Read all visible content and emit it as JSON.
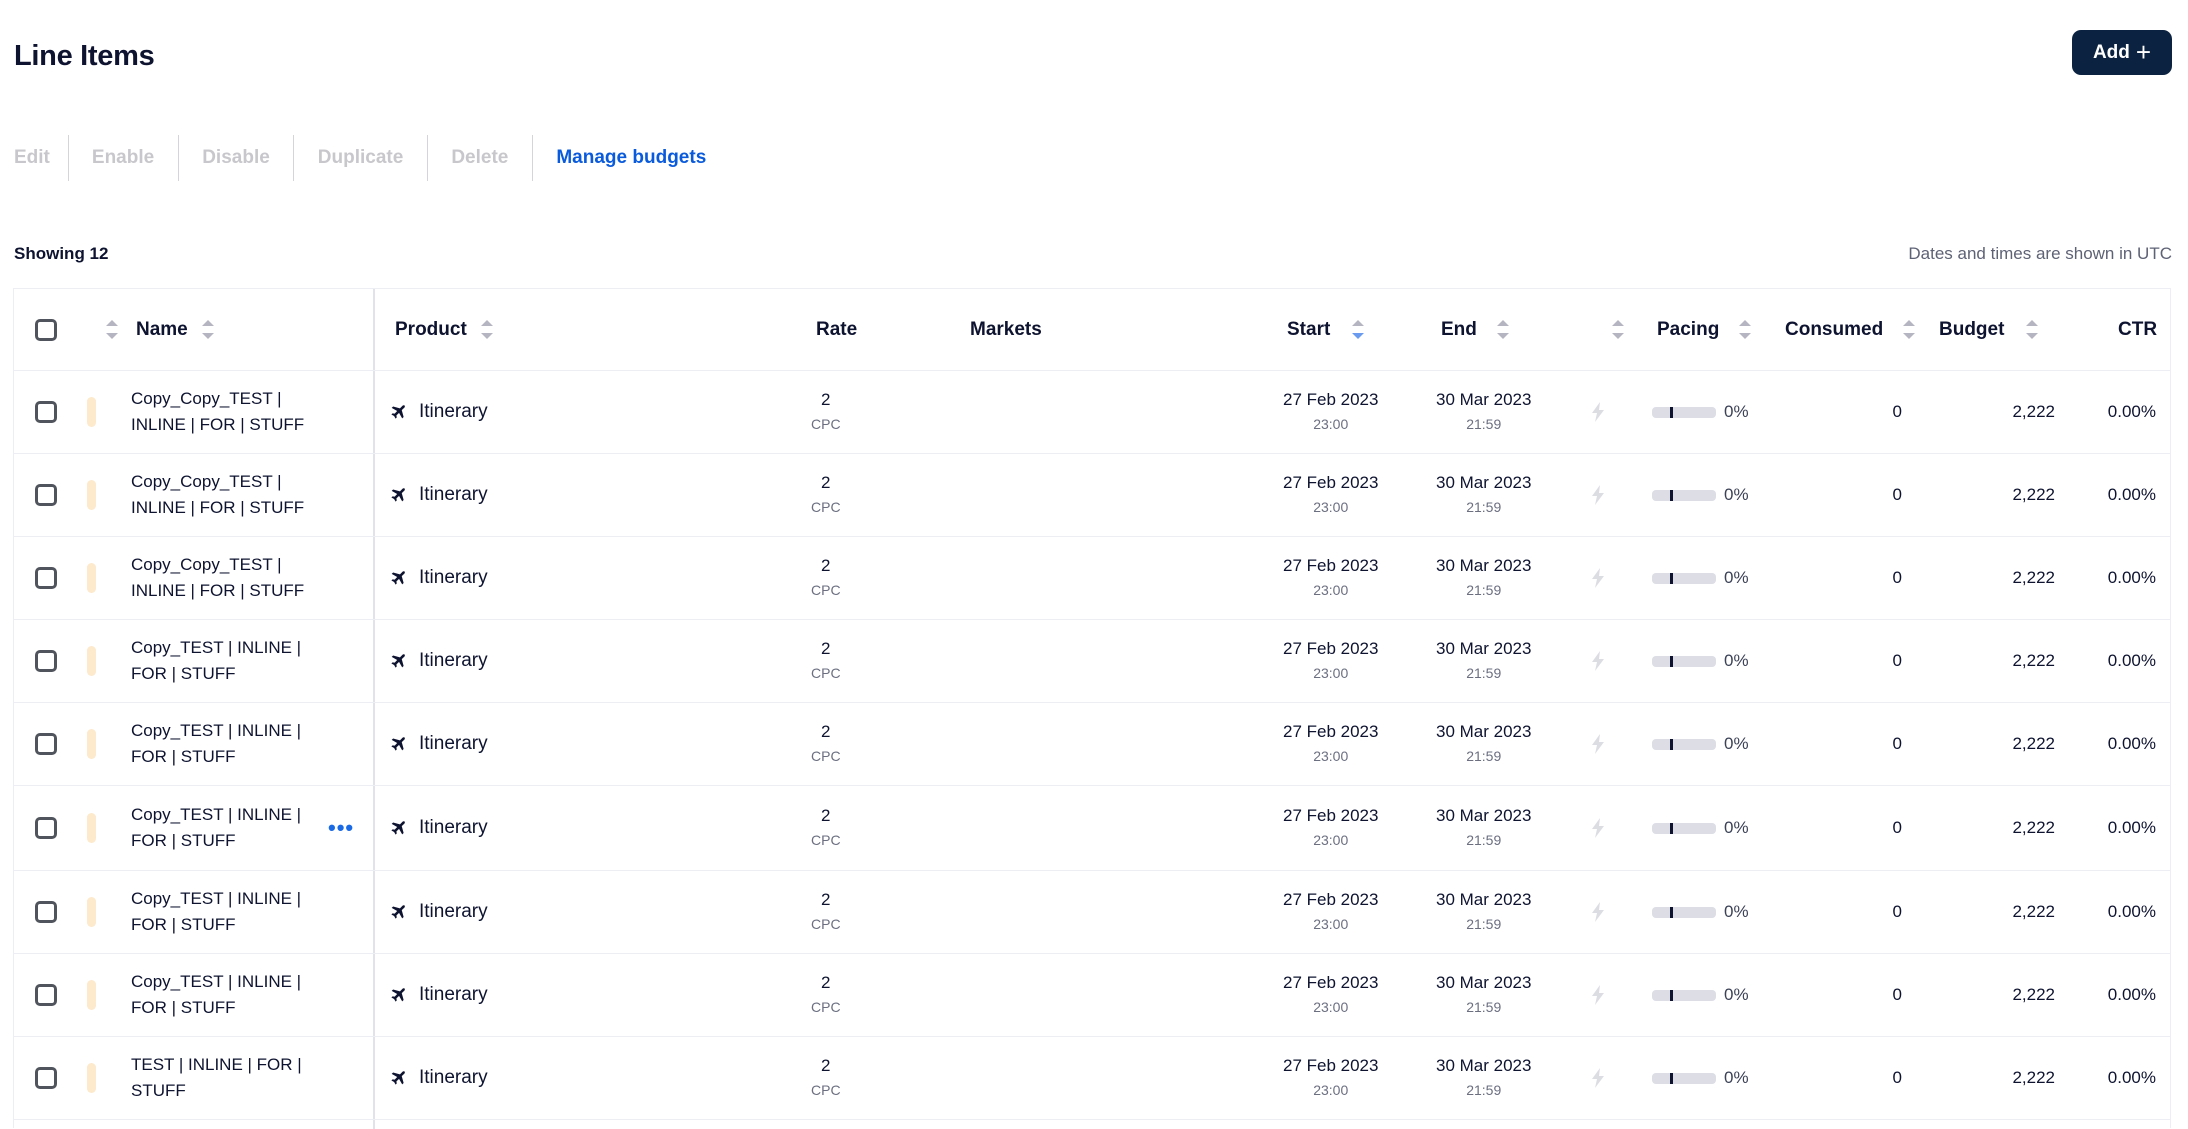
{
  "header": {
    "title": "Line Items",
    "add_button": {
      "label": "Add",
      "icon": "plus-icon"
    }
  },
  "toolbar": {
    "items": [
      {
        "label": "Edit",
        "enabled": false
      },
      {
        "label": "Enable",
        "enabled": false
      },
      {
        "label": "Disable",
        "enabled": false
      },
      {
        "label": "Duplicate",
        "enabled": false
      },
      {
        "label": "Delete",
        "enabled": false
      },
      {
        "label": "Manage budgets",
        "enabled": true
      }
    ]
  },
  "summary": {
    "showing": "Showing 12",
    "timezone_note": "Dates and times are shown in UTC"
  },
  "table": {
    "columns": {
      "name": "Name",
      "product": "Product",
      "rate": "Rate",
      "markets": "Markets",
      "start": "Start",
      "end": "End",
      "pacing": "Pacing",
      "consumed": "Consumed",
      "budget": "Budget",
      "ctr": "CTR"
    },
    "sorted_by": "start",
    "sort_direction": "descending",
    "colors": {
      "accent": "#0a5bdc",
      "status_pill": "#fde9cc",
      "add_button": "#0b2240"
    },
    "rows": [
      {
        "name": "Copy_Copy_TEST | INLINE | FOR | STUFF",
        "product": "Itinerary",
        "product_icon": "airplane-icon",
        "rate": "2",
        "rate_type": "CPC",
        "markets": "",
        "start_date": "27 Feb 2023",
        "start_time": "23:00",
        "end_date": "30 Mar 2023",
        "end_time": "21:59",
        "pacing_pct": 0,
        "pacing_label": "0%",
        "consumed": "0",
        "budget": "2,222",
        "ctr": "0.00%",
        "hover_menu": false
      },
      {
        "name": "Copy_Copy_TEST | INLINE | FOR | STUFF",
        "product": "Itinerary",
        "product_icon": "airplane-icon",
        "rate": "2",
        "rate_type": "CPC",
        "markets": "",
        "start_date": "27 Feb 2023",
        "start_time": "23:00",
        "end_date": "30 Mar 2023",
        "end_time": "21:59",
        "pacing_pct": 0,
        "pacing_label": "0%",
        "consumed": "0",
        "budget": "2,222",
        "ctr": "0.00%",
        "hover_menu": false
      },
      {
        "name": "Copy_Copy_TEST | INLINE | FOR | STUFF",
        "product": "Itinerary",
        "product_icon": "airplane-icon",
        "rate": "2",
        "rate_type": "CPC",
        "markets": "",
        "start_date": "27 Feb 2023",
        "start_time": "23:00",
        "end_date": "30 Mar 2023",
        "end_time": "21:59",
        "pacing_pct": 0,
        "pacing_label": "0%",
        "consumed": "0",
        "budget": "2,222",
        "ctr": "0.00%",
        "hover_menu": false
      },
      {
        "name": "Copy_TEST | INLINE | FOR | STUFF",
        "product": "Itinerary",
        "product_icon": "airplane-icon",
        "rate": "2",
        "rate_type": "CPC",
        "markets": "",
        "start_date": "27 Feb 2023",
        "start_time": "23:00",
        "end_date": "30 Mar 2023",
        "end_time": "21:59",
        "pacing_pct": 0,
        "pacing_label": "0%",
        "consumed": "0",
        "budget": "2,222",
        "ctr": "0.00%",
        "hover_menu": false
      },
      {
        "name": "Copy_TEST | INLINE | FOR | STUFF",
        "product": "Itinerary",
        "product_icon": "airplane-icon",
        "rate": "2",
        "rate_type": "CPC",
        "markets": "",
        "start_date": "27 Feb 2023",
        "start_time": "23:00",
        "end_date": "30 Mar 2023",
        "end_time": "21:59",
        "pacing_pct": 0,
        "pacing_label": "0%",
        "consumed": "0",
        "budget": "2,222",
        "ctr": "0.00%",
        "hover_menu": false
      },
      {
        "name": "Copy_TEST | INLINE | FOR | STUFF",
        "product": "Itinerary",
        "product_icon": "airplane-icon",
        "rate": "2",
        "rate_type": "CPC",
        "markets": "",
        "start_date": "27 Feb 2023",
        "start_time": "23:00",
        "end_date": "30 Mar 2023",
        "end_time": "21:59",
        "pacing_pct": 0,
        "pacing_label": "0%",
        "consumed": "0",
        "budget": "2,222",
        "ctr": "0.00%",
        "hover_menu": true
      },
      {
        "name": "Copy_TEST | INLINE | FOR | STUFF",
        "product": "Itinerary",
        "product_icon": "airplane-icon",
        "rate": "2",
        "rate_type": "CPC",
        "markets": "",
        "start_date": "27 Feb 2023",
        "start_time": "23:00",
        "end_date": "30 Mar 2023",
        "end_time": "21:59",
        "pacing_pct": 0,
        "pacing_label": "0%",
        "consumed": "0",
        "budget": "2,222",
        "ctr": "0.00%",
        "hover_menu": false
      },
      {
        "name": "Copy_TEST | INLINE | FOR | STUFF",
        "product": "Itinerary",
        "product_icon": "airplane-icon",
        "rate": "2",
        "rate_type": "CPC",
        "markets": "",
        "start_date": "27 Feb 2023",
        "start_time": "23:00",
        "end_date": "30 Mar 2023",
        "end_time": "21:59",
        "pacing_pct": 0,
        "pacing_label": "0%",
        "consumed": "0",
        "budget": "2,222",
        "ctr": "0.00%",
        "hover_menu": false
      },
      {
        "name": "TEST | INLINE | FOR | STUFF",
        "product": "Itinerary",
        "product_icon": "airplane-icon",
        "rate": "2",
        "rate_type": "CPC",
        "markets": "",
        "start_date": "27 Feb 2023",
        "start_time": "23:00",
        "end_date": "30 Mar 2023",
        "end_time": "21:59",
        "pacing_pct": 0,
        "pacing_label": "0%",
        "consumed": "0",
        "budget": "2,222",
        "ctr": "0.00%",
        "hover_menu": false
      }
    ],
    "row_menu_icon": "more-horizontal-icon"
  }
}
